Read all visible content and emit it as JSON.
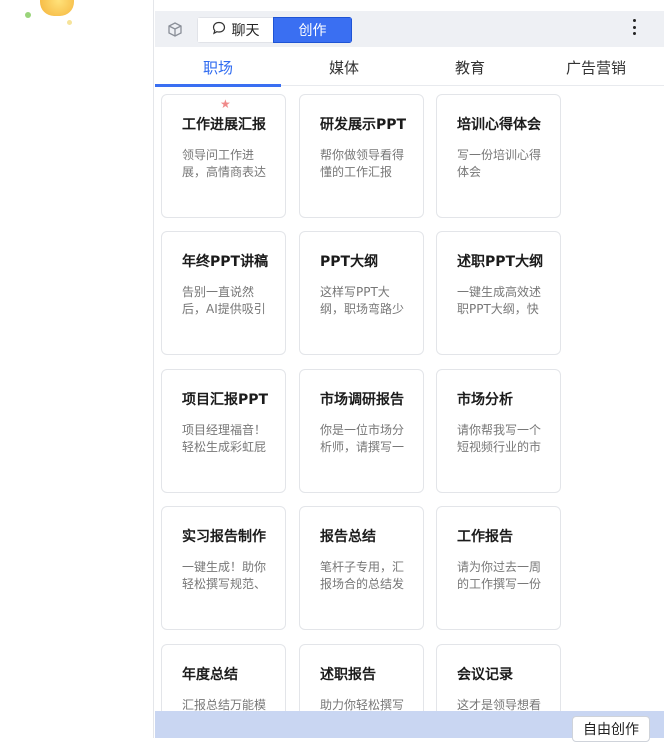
{
  "toolbar": {
    "chat_label": "聊天",
    "create_label": "创作"
  },
  "tabs": [
    {
      "label": "职场"
    },
    {
      "label": "媒体"
    },
    {
      "label": "教育"
    },
    {
      "label": "广告营销"
    }
  ],
  "cards": [
    {
      "title": "工作进展汇报",
      "desc": "领导问工作进展，高情商表达汇报工作"
    },
    {
      "title": "研发展示PPT",
      "desc": "帮你做领导看得懂的工作汇报"
    },
    {
      "title": "培训心得体会",
      "desc": "写一份培训心得体会"
    },
    {
      "title": "年终PPT讲稿",
      "desc": "告别一直说然后，AI提供吸引注意力的讲稿"
    },
    {
      "title": "PPT大纲",
      "desc": "这样写PPT大纲，职场弯路少走一半"
    },
    {
      "title": "述职PPT大纲",
      "desc": "一键生成高效述职PPT大纲，快速梳理重点"
    },
    {
      "title": "项目汇报PPT",
      "desc": "项目经理福音！轻松生成彩虹屁汇报内容"
    },
    {
      "title": "市场调研报告",
      "desc": "你是一位市场分析师，请撰写一篇市场调研"
    },
    {
      "title": "市场分析",
      "desc": "请你帮我写一个短视频行业的市场分析报告"
    },
    {
      "title": "实习报告制作",
      "desc": "一键生成！助你轻松撰写规范、内容充实的报告"
    },
    {
      "title": "报告总结",
      "desc": "笔杆子专用，汇报场合的总结发言"
    },
    {
      "title": "工作报告",
      "desc": "请为你过去一周的工作撰写一份工作报告"
    },
    {
      "title": "年度总结",
      "desc": "汇报总结万能模板"
    },
    {
      "title": "述职报告",
      "desc": "助力你轻松撰写述职报告"
    },
    {
      "title": "会议记录",
      "desc": "这才是领导想看的会议记录"
    }
  ],
  "bottom": {
    "free_create_label": "自由创作"
  },
  "colors": {
    "accent": "#3a6ff2",
    "toolbar_bg": "#eef0f4",
    "bottom_bar_bg": "#c9d6f2"
  },
  "icons": {
    "cube": "cube-icon",
    "chat": "chat-bubble-icon",
    "more": "more-vertical-icon",
    "star": "star-icon"
  }
}
